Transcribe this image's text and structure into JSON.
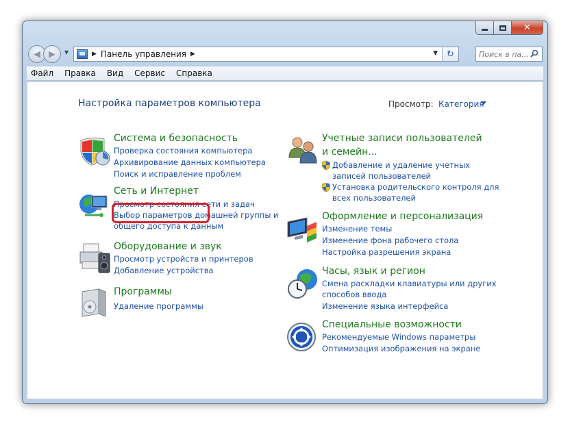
{
  "window": {
    "address": {
      "crumb": "Панель управления"
    },
    "search": {
      "placeholder": "Поиск в па..."
    }
  },
  "menu": [
    "Файл",
    "Правка",
    "Вид",
    "Сервис",
    "Справка"
  ],
  "page": {
    "title": "Настройка параметров компьютера",
    "view_label": "Просмотр:",
    "view_value": "Категория"
  },
  "categories": {
    "system": {
      "title": "Система и безопасность",
      "links": [
        "Проверка состояния компьютера",
        "Архивирование данных компьютера",
        "Поиск и исправление проблем"
      ]
    },
    "network": {
      "title": "Сеть и Интернет",
      "links": [
        "Просмотр состояния сети и задач",
        "Выбор параметров домашней группы и",
        "общего доступа к данным"
      ]
    },
    "hardware": {
      "title": "Оборудование и звук",
      "links": [
        "Просмотр устройств и принтеров",
        "Добавление устройства"
      ]
    },
    "programs": {
      "title": "Программы",
      "links": [
        "Удаление программы"
      ]
    },
    "users": {
      "title_line1": "Учетные записи пользователей",
      "title_line2": "и семейн...",
      "links": [
        "Добавление и удаление учетных",
        "записей пользователей",
        "Установка родительского контроля для",
        "всех пользователей"
      ]
    },
    "appearance": {
      "title": "Оформление и персонализация",
      "links": [
        "Изменение темы",
        "Изменение фона рабочего стола",
        "Настройка разрешения экрана"
      ]
    },
    "clock": {
      "title": "Часы, язык и регион",
      "links": [
        "Смена раскладки клавиатуры или других",
        "способов ввода",
        "Изменение языка интерфейса"
      ]
    },
    "access": {
      "title": "Специальные возможности",
      "links": [
        "Рекомендуемые Windows параметры",
        "Оптимизация изображения на экране"
      ]
    }
  },
  "colors": {
    "category_title": "#1e7a1e",
    "link": "#1c4fa4",
    "page_title": "#1e3f7a",
    "highlight": "#d2202a"
  }
}
